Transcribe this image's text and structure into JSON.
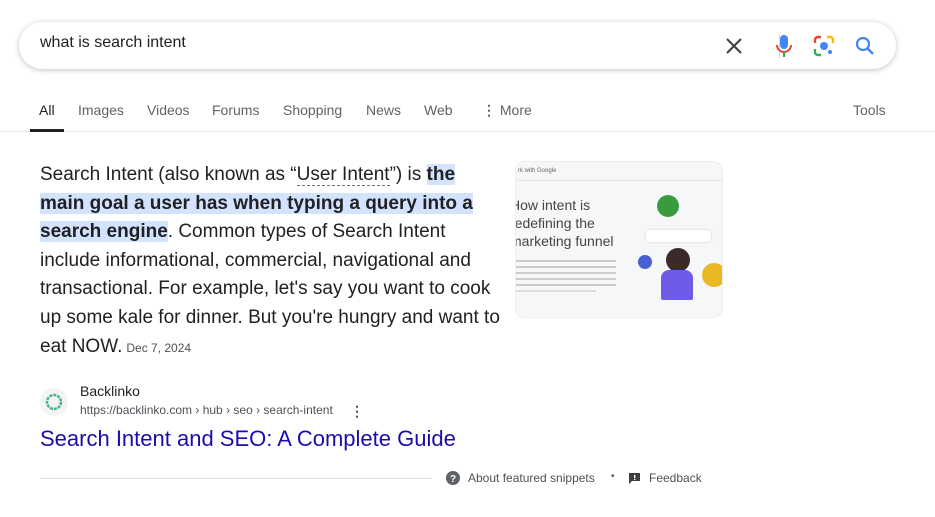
{
  "search": {
    "query": "what is search intent",
    "icons": [
      "close-icon",
      "mic-icon",
      "lens-icon",
      "search-icon"
    ]
  },
  "tabs": [
    {
      "label": "All"
    },
    {
      "label": "Images"
    },
    {
      "label": "Videos"
    },
    {
      "label": "Forums"
    },
    {
      "label": "Shopping"
    },
    {
      "label": "News"
    },
    {
      "label": "Web"
    },
    {
      "label": "More"
    }
  ],
  "tools_label": "Tools",
  "snippet": {
    "pre": "Search Intent (also known as “",
    "term": "User Intent",
    "mid": "”) is ",
    "highlight": "the main goal a user has when typing a query into a search engine",
    "post": ". Common types of Search Intent include informational, commercial, navigational and transactional. For example, let's say you want to cook up some kale for dinner. But you're hungry and want to eat NOW.",
    "date": "Dec 7, 2024"
  },
  "thumbnail": {
    "header": "rk with Google",
    "title": "How intent is redefining the marketing funnel"
  },
  "result": {
    "site": "Backlinko",
    "url": "https://backlinko.com › hub › seo › search-intent",
    "title": "Search Intent and SEO: A Complete Guide"
  },
  "footer": {
    "about": "About featured snippets",
    "separator": "•",
    "feedback": "Feedback"
  },
  "colors": {
    "link": "#1a0dab",
    "highlight": "#d3e3fd",
    "accent": "#4285f4"
  }
}
